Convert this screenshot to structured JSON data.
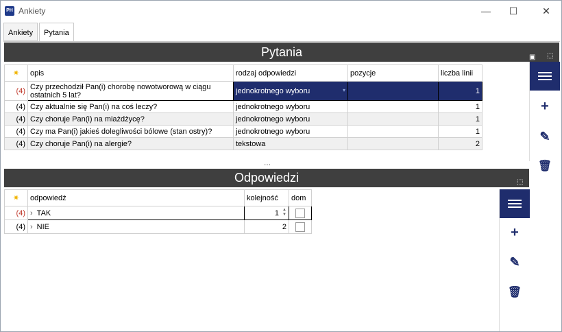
{
  "window": {
    "app_icon": "PH",
    "title": "Ankiety",
    "minimize": "—",
    "maximize": "☐",
    "close": "✕"
  },
  "tabs": [
    {
      "label": "Ankiety"
    },
    {
      "label": "Pytania"
    }
  ],
  "pytania": {
    "title": "Pytania",
    "columns": {
      "star": "✷",
      "opis": "opis",
      "rodzaj": "rodzaj odpowiedzi",
      "pozycje": "pozycje",
      "liczba": "liczba linii"
    },
    "rows": [
      {
        "idx": "(4)",
        "opis": "Czy przechodził Pan(i) chorobę nowotworową w ciągu ostatnich 5 lat?",
        "rodzaj": "jednokrotnego wyboru",
        "pozycje": "",
        "liczba": "1"
      },
      {
        "idx": "(4)",
        "opis": "Czy aktualnie się Pan(i) na coś leczy?",
        "rodzaj": "jednokrotnego wyboru",
        "pozycje": "",
        "liczba": "1"
      },
      {
        "idx": "(4)",
        "opis": "Czy choruje Pan(i) na miażdżycę?",
        "rodzaj": "jednokrotnego wyboru",
        "pozycje": "",
        "liczba": "1"
      },
      {
        "idx": "(4)",
        "opis": "Czy ma Pan(i) jakieś dolegliwości bólowe (stan ostry)?",
        "rodzaj": "jednokrotnego wyboru",
        "pozycje": "",
        "liczba": "1"
      },
      {
        "idx": "(4)",
        "opis": "Czy choruje Pan(i) na alergie?",
        "rodzaj": "tekstowa",
        "pozycje": "",
        "liczba": "2"
      }
    ]
  },
  "odpowiedzi": {
    "title": "Odpowiedzi",
    "columns": {
      "star": "✷",
      "odpowiedz": "odpowiedź",
      "kolejnosc": "kolejność",
      "dom": "dom"
    },
    "rows": [
      {
        "idx": "(4)",
        "odpowiedz": "TAK",
        "kolejnosc": "1"
      },
      {
        "idx": "(4)",
        "odpowiedz": "NIE",
        "kolejnosc": "2"
      }
    ]
  },
  "icons": {
    "plus": "+",
    "edit": "✎",
    "trash": "🗑",
    "chevron": "›",
    "dropdown": "▾",
    "spin_up": "▲",
    "spin_down": "▼",
    "splitter": "⋯"
  },
  "colors": {
    "accent": "#1f2d6d",
    "header": "#3f3f3f",
    "index_red": "#c0392b"
  }
}
